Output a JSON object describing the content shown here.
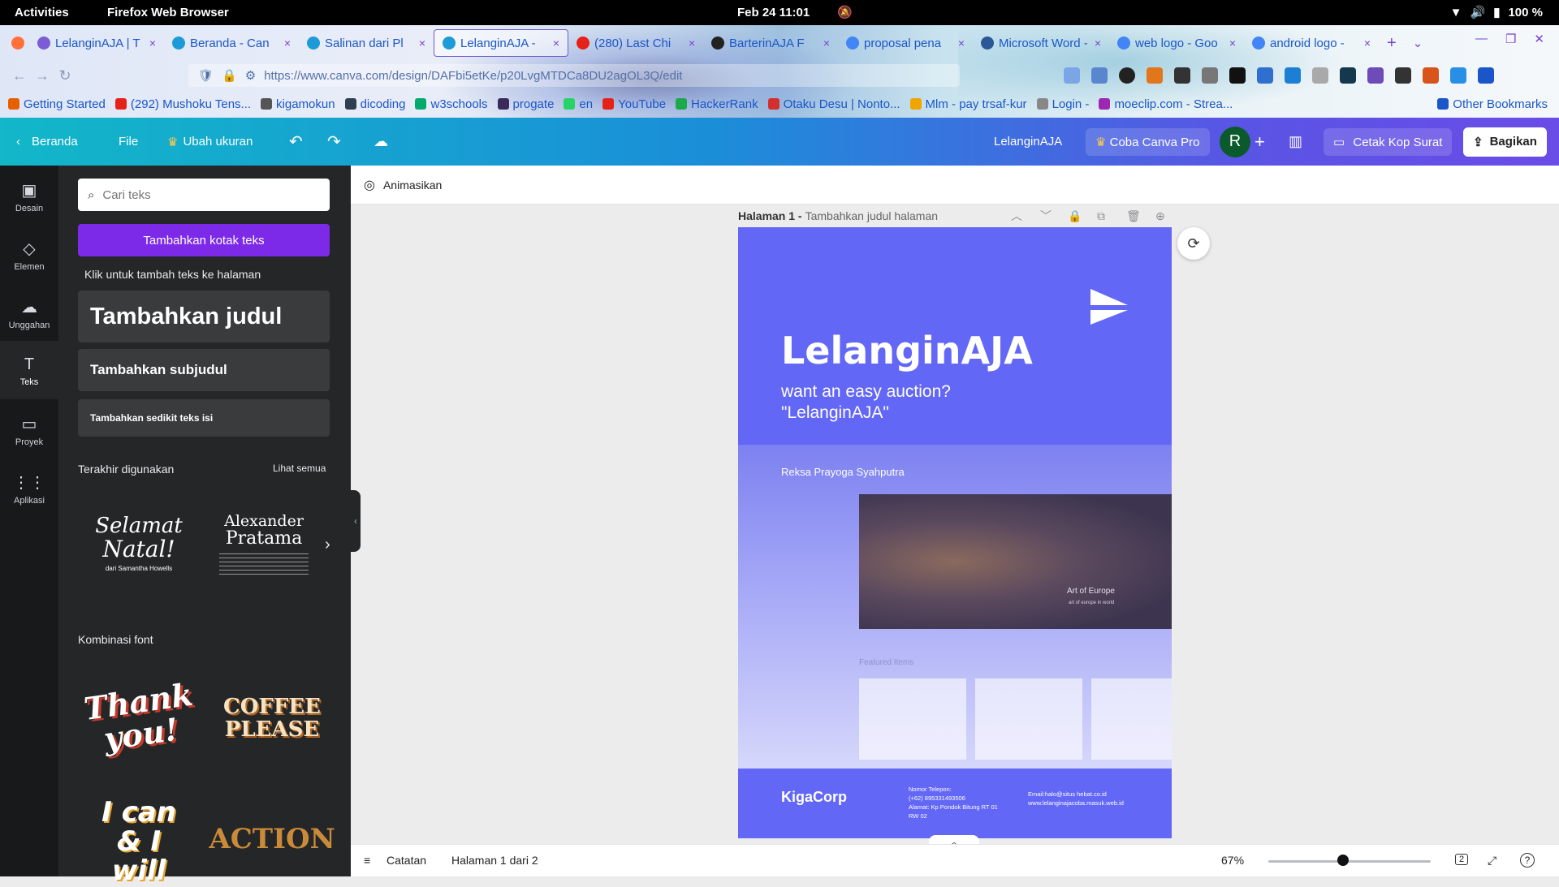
{
  "topbar": {
    "activities": "Activities",
    "app": "Firefox Web Browser",
    "clock": "Feb 24  11:01",
    "battery": "100 %"
  },
  "browser": {
    "tabs": [
      {
        "label": "LelanginAJA | T",
        "color": "#7b5cd6"
      },
      {
        "label": "Beranda - Can",
        "color": "#1c9bd8"
      },
      {
        "label": "Salinan dari Pl",
        "color": "#1c9bd8"
      },
      {
        "label": "LelanginAJA - ",
        "color": "#1c9bd8",
        "active": true
      },
      {
        "label": "(280) Last Chi",
        "color": "#e62117"
      },
      {
        "label": "BarterinAJA F",
        "color": "#222222"
      },
      {
        "label": "proposal pena",
        "color": "#4285f4"
      },
      {
        "label": "Microsoft Word - ",
        "color": "#2b5797"
      },
      {
        "label": "web logo - Goo",
        "color": "#4285f4"
      },
      {
        "label": "android logo - ",
        "color": "#4285f4"
      }
    ],
    "url": "https://www.canva.com/design/DAFbi5etKe/p20LvgMTDCa8DU2agOL3Q/edit",
    "bookmarks": [
      {
        "label": "Getting Started",
        "color": "#e66000"
      },
      {
        "label": "(292) Mushoku Tens...",
        "color": "#e62117"
      },
      {
        "label": "kigamokun",
        "color": "#555555"
      },
      {
        "label": "dicoding",
        "color": "#2d3e50"
      },
      {
        "label": "w3schools",
        "color": "#04aa6d"
      },
      {
        "label": "progate",
        "color": "#3a2b5a"
      },
      {
        "label": "en",
        "color": "#25d366"
      },
      {
        "label": "YouTube",
        "color": "#e62117"
      },
      {
        "label": "HackerRank",
        "color": "#1ba94c"
      },
      {
        "label": "Otaku Desu | Nonto...",
        "color": "#d32f2f"
      },
      {
        "label": "Mlm - pay trsaf-kur",
        "color": "#f0a500"
      },
      {
        "label": "Login -",
        "color": "#888888"
      },
      {
        "label": "moeclip.com - Strea...",
        "color": "#9c27b0"
      }
    ],
    "other_bookmarks": "Other Bookmarks"
  },
  "canva_header": {
    "home": "Beranda",
    "file": "File",
    "resize": "Ubah ukuran",
    "doc_title": "LelanginAJA",
    "pro": "Coba Canva Pro",
    "avatar": "R",
    "print": "Cetak Kop Surat",
    "share": "Bagikan"
  },
  "rail": [
    {
      "label": "Desain",
      "icon": "layout-icon"
    },
    {
      "label": "Elemen",
      "icon": "shapes-icon"
    },
    {
      "label": "Unggahan",
      "icon": "cloud-upload-icon"
    },
    {
      "label": "Teks",
      "icon": "text-icon",
      "active": true
    },
    {
      "label": "Proyek",
      "icon": "folder-icon"
    },
    {
      "label": "Aplikasi",
      "icon": "apps-icon"
    }
  ],
  "panel": {
    "search_placeholder": "Cari teks",
    "add_textbox": "Tambahkan kotak teks",
    "hint": "Klik untuk tambah teks ke halaman",
    "heading": "Tambahkan judul",
    "subheading": "Tambahkan subjudul",
    "body": "Tambahkan sedikit teks isi",
    "recent_title": "Terakhir digunakan",
    "see_all": "Lihat semua",
    "recent": [
      {
        "line1": "Selamat",
        "line2": "Natal!",
        "line3": "dari Samantha Howells"
      },
      {
        "line1": "Alexander",
        "line2": "Pratama"
      }
    ],
    "combos_title": "Kombinasi font",
    "combos": [
      "Thank you!",
      "COFFEE PLEASE",
      "I can & I will",
      "ACTION"
    ]
  },
  "editor": {
    "animate": "Animasikan",
    "page_label": "Halaman 1 - ",
    "page_title_placeholder": "Tambahkan judul halaman",
    "notes": "Catatan",
    "page_counter": "Halaman 1 dari 2",
    "zoom": "67%",
    "zoom_fraction": 0.46,
    "pages_count": "2"
  },
  "design": {
    "title": "LelanginAJA",
    "subtitle_line1": "want an easy auction?",
    "subtitle_line2": "\"LelanginAJA\"",
    "author": "Reksa Prayoga Syahputra",
    "screenshot_caption": "Art of Europe",
    "screenshot_subcaption": "art of europe in world",
    "featured": "Featured Items",
    "brand": "KigaCorp",
    "phone_label": "Nomor Telepon:",
    "phone": "(+62) 895331493506",
    "address": "Alamat: Kp Pondok Bitung RT 01",
    "address2": "RW 02",
    "email": "Email:halo@situs hebat.co.id",
    "web": "www.lelanginajacoba.masuk.web.id",
    "accent": "#6367f6"
  }
}
